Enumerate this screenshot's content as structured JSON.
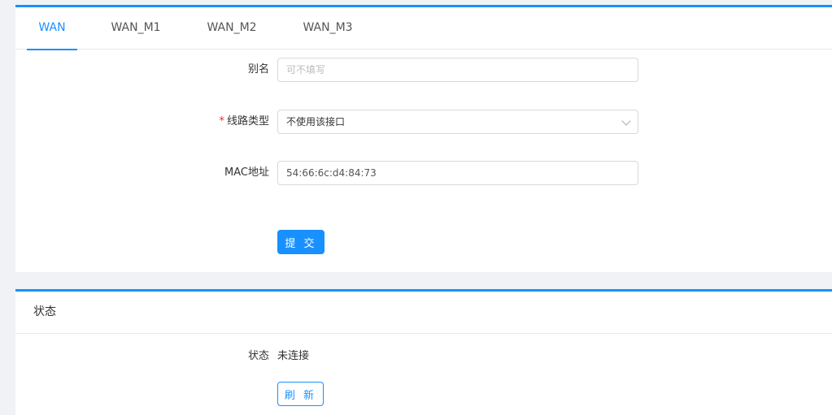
{
  "tabs": [
    {
      "label": "WAN",
      "active": true
    },
    {
      "label": "WAN_M1",
      "active": false
    },
    {
      "label": "WAN_M2",
      "active": false
    },
    {
      "label": "WAN_M3",
      "active": false
    }
  ],
  "form": {
    "alias": {
      "label": "别名",
      "value": "",
      "placeholder": "可不填写"
    },
    "line_type": {
      "required_mark": "*",
      "label": "线路类型",
      "value": "不使用该接口"
    },
    "mac": {
      "label": "MAC地址",
      "value": "54:66:6c:d4:84:73"
    },
    "submit_label": "提 交"
  },
  "status": {
    "header": "状态",
    "label": "状态",
    "value": "未连接",
    "refresh_label": "刷 新"
  },
  "colors": {
    "accent": "#1890ff",
    "required": "#f5222d",
    "background": "#f0f2f5"
  }
}
